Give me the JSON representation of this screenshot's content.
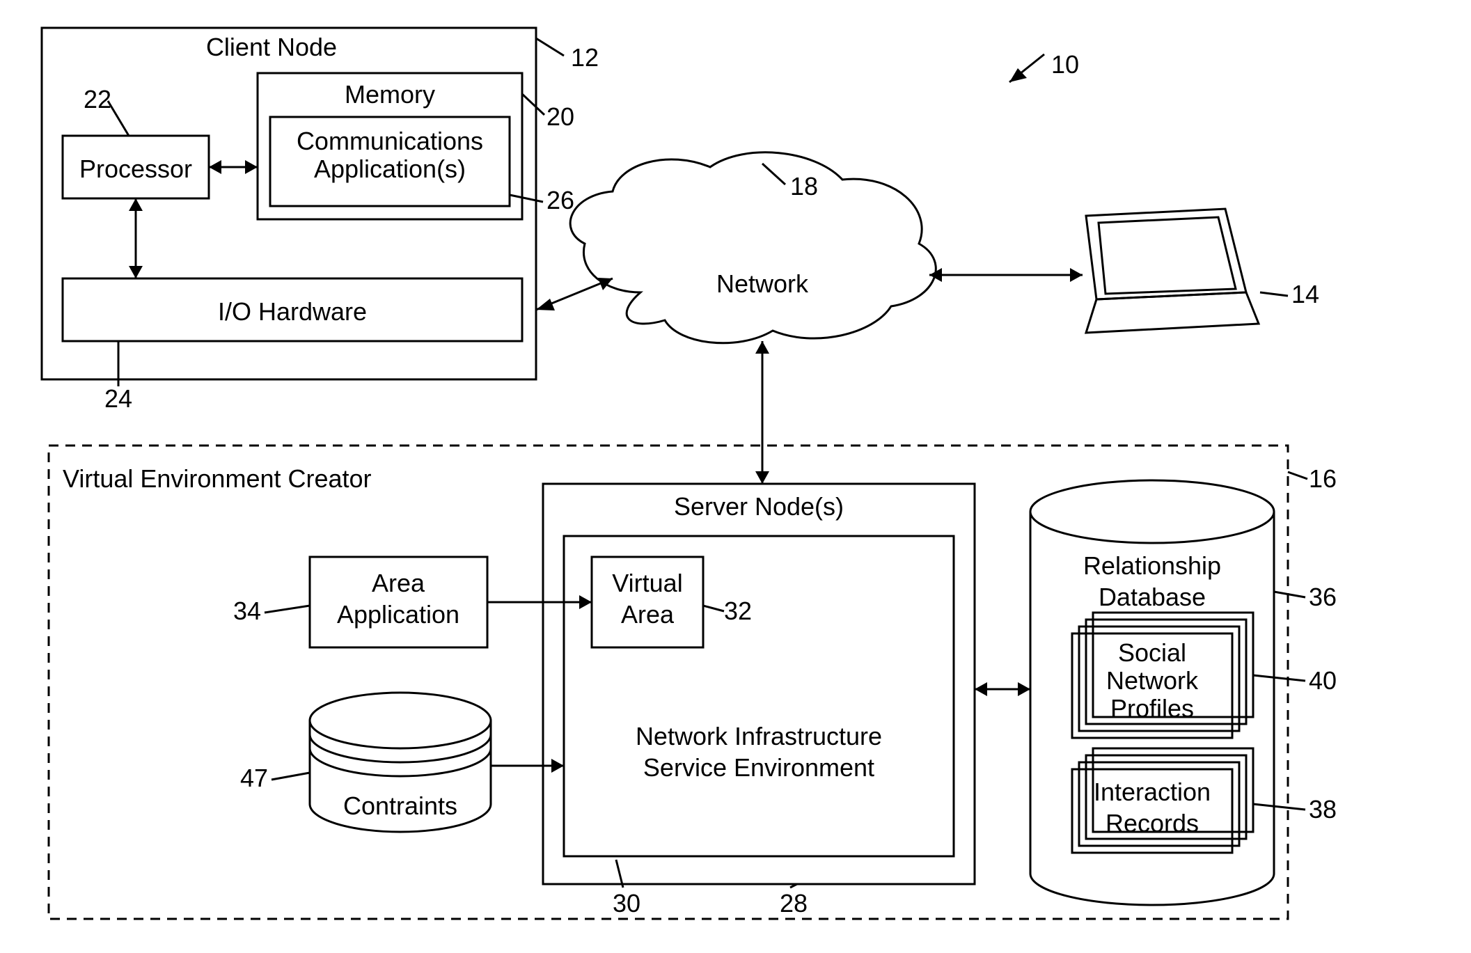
{
  "refs": {
    "r10": "10",
    "r12": "12",
    "r14": "14",
    "r16": "16",
    "r18": "18",
    "r20": "20",
    "r22": "22",
    "r24": "24",
    "r26": "26",
    "r28": "28",
    "r30": "30",
    "r32": "32",
    "r34": "34",
    "r36": "36",
    "r38": "38",
    "r40": "40",
    "r47": "47"
  },
  "labels": {
    "client_node": "Client Node",
    "memory": "Memory",
    "processor": "Processor",
    "comm_app_1": "Communications",
    "comm_app_2": "Application(s)",
    "io_hw": "I/O Hardware",
    "network": "Network",
    "vec": "Virtual Environment Creator",
    "server_nodes": "Server Node(s)",
    "virtual_area_1": "Virtual",
    "virtual_area_2": "Area",
    "nise_1": "Network Infrastructure",
    "nise_2": "Service Environment",
    "area_app_1": "Area",
    "area_app_2": "Application",
    "constraints": "Contraints",
    "rel_db_1": "Relationship",
    "rel_db_2": "Database",
    "snp_1": "Social",
    "snp_2": "Network",
    "snp_3": "Profiles",
    "ir_1": "Interaction",
    "ir_2": "Records"
  }
}
